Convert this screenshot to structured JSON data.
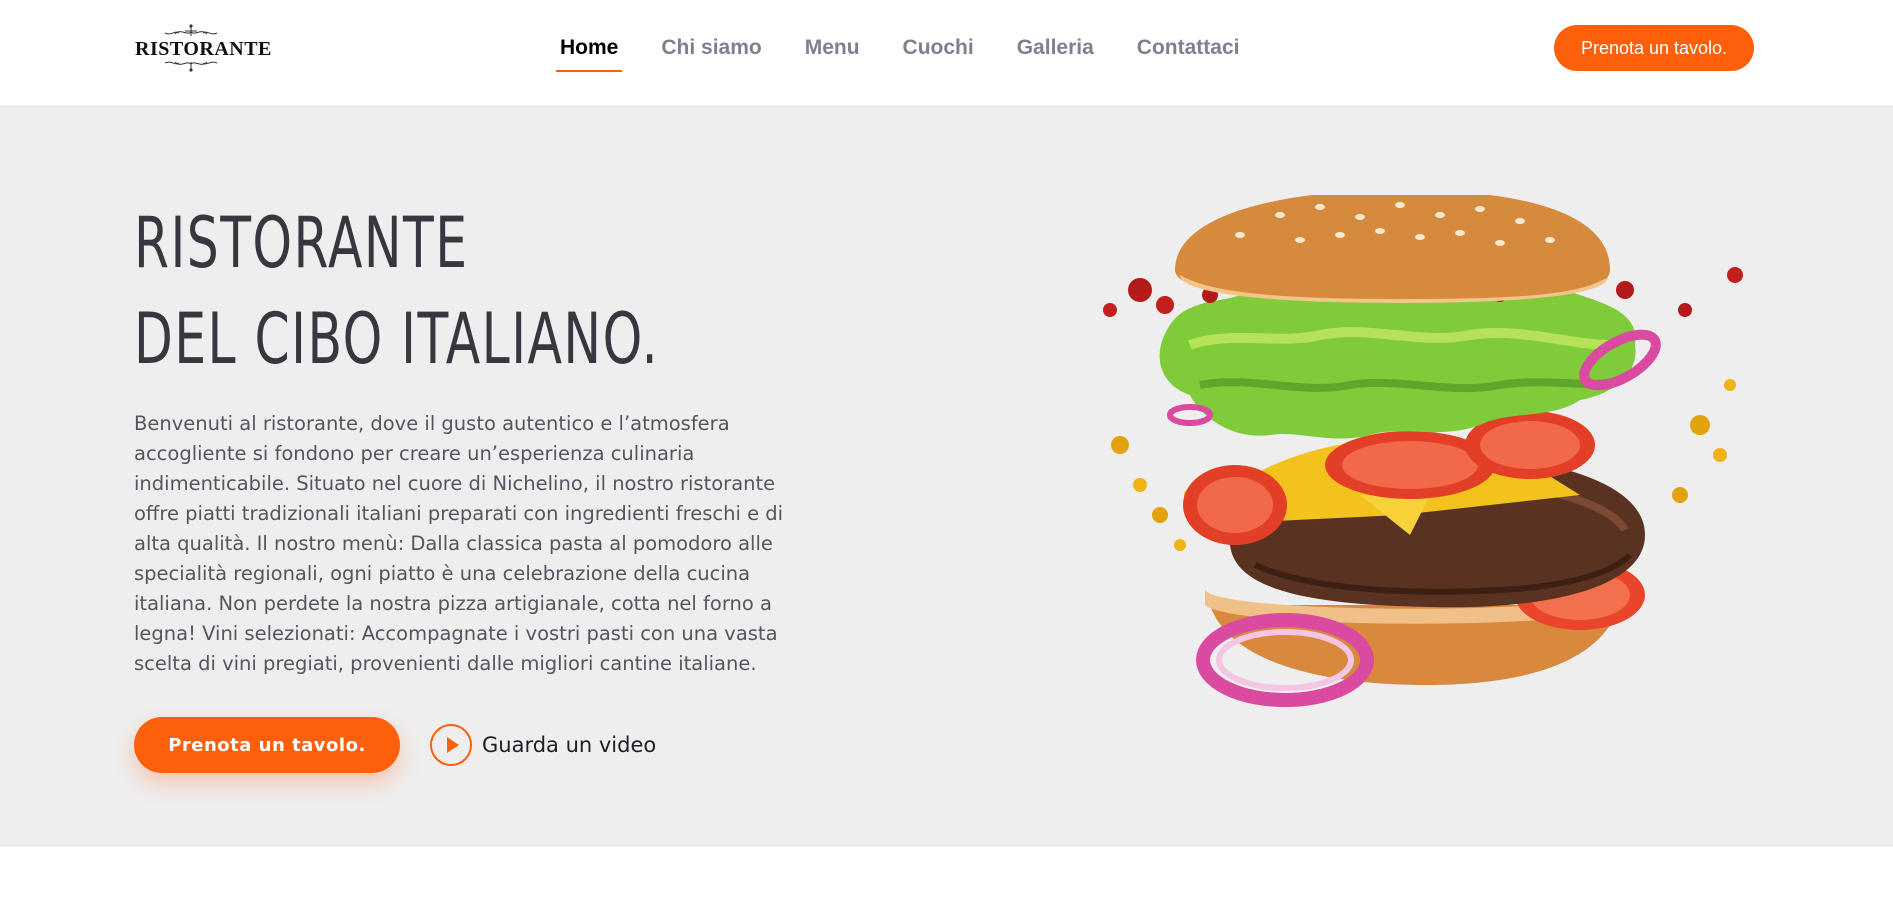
{
  "brand": {
    "logo_text": "RISTORANTE"
  },
  "nav": {
    "items": [
      {
        "label": "Home",
        "active": true
      },
      {
        "label": "Chi siamo",
        "active": false
      },
      {
        "label": "Menu",
        "active": false
      },
      {
        "label": "Cuochi",
        "active": false
      },
      {
        "label": "Galleria",
        "active": false
      },
      {
        "label": "Contattaci",
        "active": false
      }
    ]
  },
  "header": {
    "cta_label": "Prenota un tavolo."
  },
  "hero": {
    "title_line1": "RISTORANTE",
    "title_line2": "DEL CIBO ITALIANO.",
    "description": "Benvenuti al ristorante, dove il gusto autentico e l’atmosfera accogliente si fondono per creare un’esperienza culinaria indimenticabile. Situato nel cuore di Nichelino, il nostro ristorante offre piatti tradizionali italiani preparati con ingredienti freschi e di alta qualità. Il nostro menù: Dalla classica pasta al pomodoro alle specialità regionali, ogni piatto è una celebrazione della cucina italiana. Non perdete la nostra pizza artigianale, cotta nel forno a legna! Vini selezionati: Accompagnate i vostri pasti con una vasta scelta di vini pregiati, provenienti dalle migliori cantine italiane.",
    "cta_label": "Prenota un tavolo.",
    "video_label": "Guarda un video",
    "image_icon": "burger-image"
  },
  "colors": {
    "accent": "#fe5f0a",
    "hero_bg": "#eeeeee",
    "nav_active": "#000000",
    "nav_inactive": "#7f7f90",
    "title": "#37373f"
  }
}
